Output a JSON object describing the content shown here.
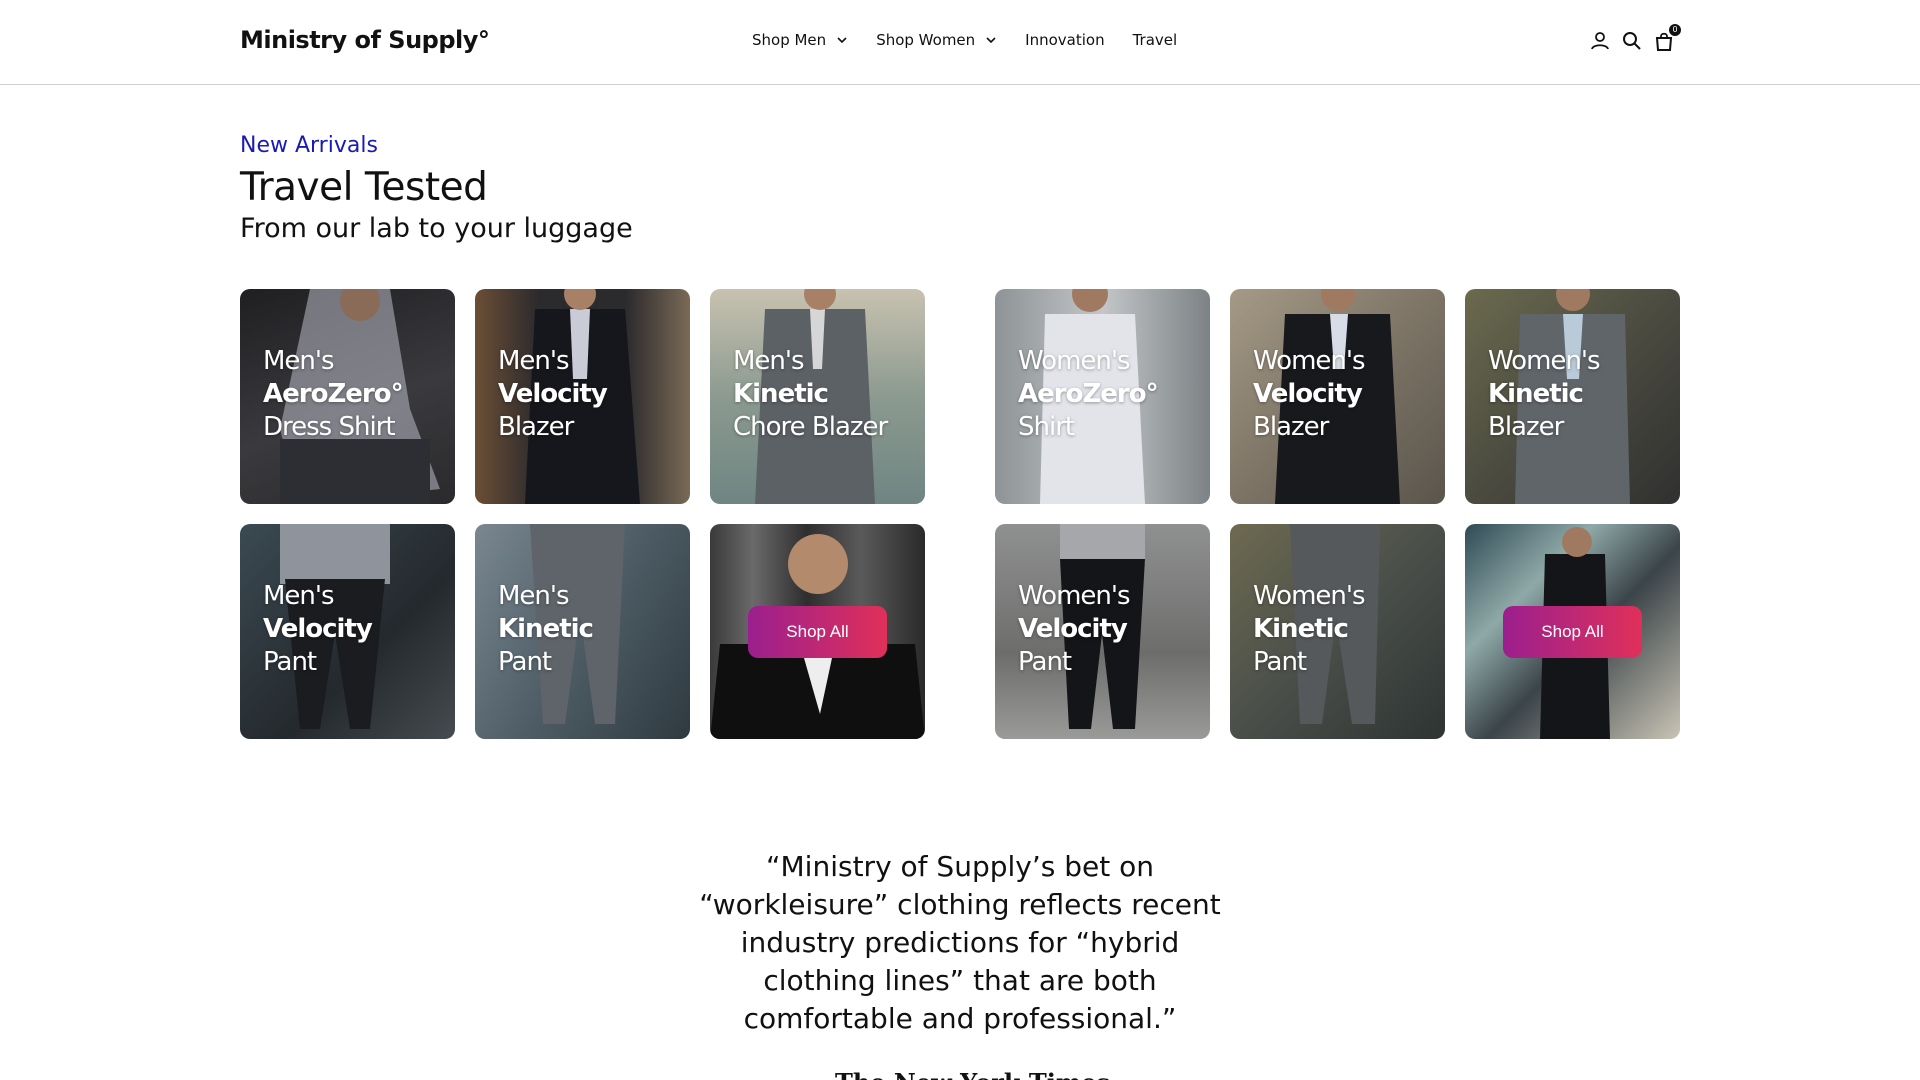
{
  "header": {
    "logo": "Ministry of Supply°",
    "nav": [
      {
        "label": "Shop Men",
        "has_dropdown": true
      },
      {
        "label": "Shop Women",
        "has_dropdown": true
      },
      {
        "label": "Innovation",
        "has_dropdown": false
      },
      {
        "label": "Travel",
        "has_dropdown": false
      }
    ],
    "icons": [
      "account-icon",
      "search-icon",
      "cart-icon"
    ],
    "cart_count": "0"
  },
  "section": {
    "eyebrow": "New Arrivals",
    "title": "Travel Tested",
    "subtitle": "From our lab to your luggage"
  },
  "men_tiles": [
    {
      "line1": "Men's",
      "line2": "AeroZero°",
      "line3": "Dress Shirt"
    },
    {
      "line1": "Men's",
      "line2": "Velocity",
      "line3": "Blazer"
    },
    {
      "line1": "Men's",
      "line2": "Kinetic",
      "line3": "Chore Blazer"
    },
    {
      "line1": "Men's",
      "line2": "Velocity",
      "line3": "Pant"
    },
    {
      "line1": "Men's",
      "line2": "Kinetic",
      "line3": "Pant"
    }
  ],
  "women_tiles": [
    {
      "line1": "Women's",
      "line2": "AeroZero°",
      "line3": "Shirt"
    },
    {
      "line1": "Women's",
      "line2": "Velocity",
      "line3": "Blazer"
    },
    {
      "line1": "Women's",
      "line2": "Kinetic",
      "line3": "Blazer"
    },
    {
      "line1": "Women's",
      "line2": "Velocity",
      "line3": "Pant"
    },
    {
      "line1": "Women's",
      "line2": "Kinetic",
      "line3": "Pant"
    }
  ],
  "shop_all_men": "Shop All",
  "shop_all_women": "Shop All",
  "quote": "“Ministry of Supply’s bet on “workleisure” clothing reflects recent industry predictions for “hybrid clothing lines” that are both comfortable and professional.”",
  "press_logo": "The New York Times",
  "colors": {
    "eyebrow": "#1a1ab4",
    "button_gradient_start": "#9b1f8e",
    "button_gradient_end": "#e0305a"
  }
}
